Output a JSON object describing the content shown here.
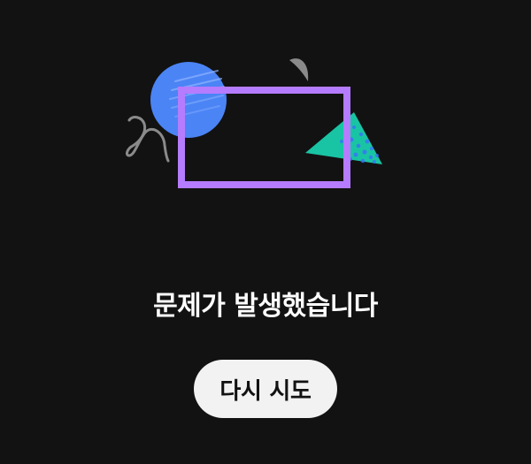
{
  "error": {
    "message": "문제가 발생했습니다",
    "retry_label": "다시 시도"
  },
  "colors": {
    "background": "#121212",
    "frame": "#b57cff",
    "circle": "#4b84f5",
    "triangle": "#19c4a4",
    "triangle_texture": "#3b6cff",
    "squiggle": "#8a8a8a",
    "half_moon": "#8a8a8a",
    "button_bg": "#f2f2f2",
    "text": "#ffffff"
  },
  "icons": {
    "illustration": "error-illustration",
    "shapes": [
      "blue-circle-icon",
      "purple-frame-icon",
      "green-triangle-icon",
      "gray-squiggle-icon",
      "gray-half-moon-icon"
    ]
  }
}
